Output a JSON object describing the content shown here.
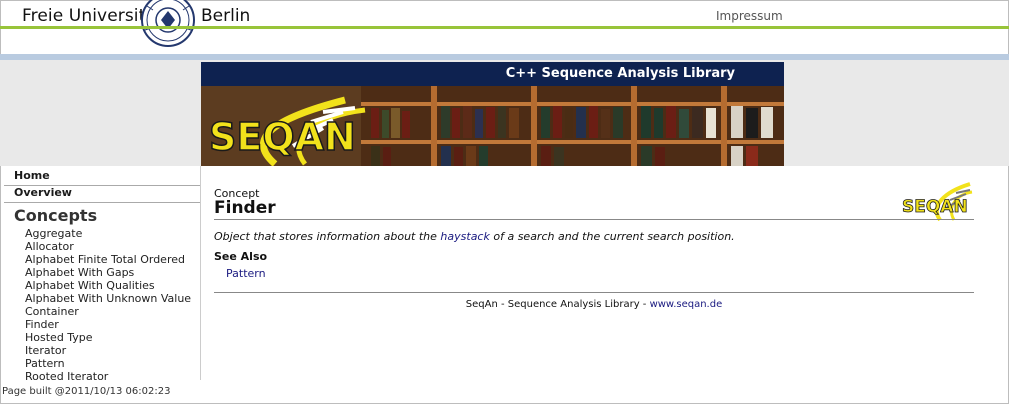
{
  "header": {
    "university_left": "Freie Universität",
    "university_right": "Berlin",
    "impressum": "Impressum"
  },
  "banner": {
    "title": "C++ Sequence Analysis Library",
    "logo_text": "SEQAN"
  },
  "sidebar": {
    "home": "Home",
    "overview": "Overview",
    "concepts_heading": "Concepts",
    "concepts": [
      "Aggregate",
      "Allocator",
      "Alphabet Finite Total Ordered",
      "Alphabet With Gaps",
      "Alphabet With Qualities",
      "Alphabet With Unknown Value",
      "Container",
      "Finder",
      "Hosted Type",
      "Iterator",
      "Pattern",
      "Rooted Iterator"
    ]
  },
  "main": {
    "kind": "Concept",
    "title": "Finder",
    "logo_text": "SEQAN",
    "description_before": "Object that stores information about the ",
    "description_link": "haystack",
    "description_after": " of a search and the current search position.",
    "see_also_heading": "See Also",
    "see_also_link": "Pattern",
    "footer_text": "SeqAn - Sequence Analysis Library - ",
    "footer_link": "www.seqan.de"
  },
  "status": {
    "built": "Page built @2011/10/13 06:02:23"
  },
  "colors": {
    "green_rule": "#98c43a",
    "blue_rule": "#b9cbe0",
    "banner_navy": "#0e2250",
    "logo_yellow": "#f2e21b",
    "link_blue": "#1a1a80"
  }
}
